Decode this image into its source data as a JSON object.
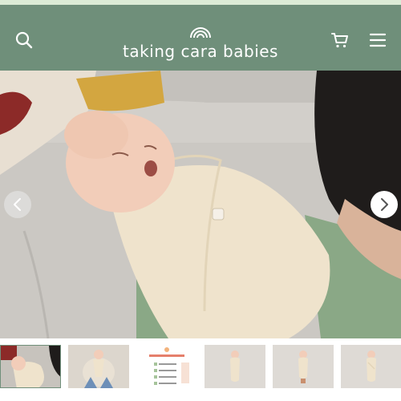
{
  "header": {
    "brand": "taking cara babies",
    "background": "#6f8f7a",
    "icons": [
      "search-icon",
      "cart-icon",
      "menu-icon"
    ]
  },
  "gallery": {
    "main_image": "baby swaddled in cream swaddle lying on a couch, adult with green sleeve beside",
    "thumbnail_count": 6,
    "thumbnail_text": "SLEEP SWADDLE GUIDE"
  }
}
